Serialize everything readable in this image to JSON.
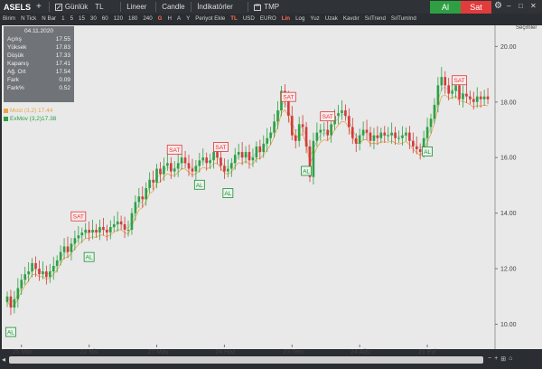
{
  "toolbar": {
    "symbol": "ASELS",
    "add_label": "+",
    "period_label": "Günlük",
    "currency": "TL",
    "scale": "Lineer",
    "chart_type": "Candle",
    "indicators_label": "İndikatörler",
    "template_label": "TMP",
    "buy_label": "Al",
    "sell_label": "Sat",
    "win_min": "–",
    "win_max": "□",
    "win_close": "✕"
  },
  "subtoolbar": {
    "items": [
      "Birim",
      "N Tick",
      "N Bar",
      "1",
      "5",
      "15",
      "30",
      "60",
      "120",
      "180",
      "240",
      "G",
      "H",
      "A",
      "Y",
      "Periyot Ekle",
      "TL",
      "USD",
      "EURO",
      "Lin",
      "Log",
      "Yuz",
      "Uzak",
      "Kavdır",
      "SılTrend",
      "SılTumInd"
    ]
  },
  "info": {
    "date": "04.11.2020",
    "rows": [
      {
        "label": "Açılış",
        "value": "17.55"
      },
      {
        "label": "Yüksek",
        "value": "17.83"
      },
      {
        "label": "Düşük",
        "value": "17.33"
      },
      {
        "label": "Kapanış",
        "value": "17.41"
      },
      {
        "label": "Ağ. Ort",
        "value": "17.54"
      },
      {
        "label": "Fark",
        "value": "0.09"
      },
      {
        "label": "Fark%",
        "value": "0.52"
      }
    ]
  },
  "legend": [
    {
      "label": "Most (3,2) 17.44",
      "color": "#e8a54a"
    },
    {
      "label": "ExMov (3,2)17.38",
      "color": "#2ea043"
    }
  ],
  "secimler": "Seçimler",
  "chart_data": {
    "type": "candlestick",
    "y_ticks": [
      10.0,
      12.0,
      14.0,
      16.0,
      18.0,
      20.0
    ],
    "ylim": [
      9.3,
      20.5
    ],
    "x_ticks": [
      "25 Mar",
      "22 Nis",
      "27 May",
      "24 Haz",
      "23 Tem",
      "24 Ağu",
      "21 Eyl"
    ],
    "x_tick_index": [
      4,
      23,
      42,
      61,
      80,
      99,
      118
    ],
    "closes": [
      11.0,
      10.6,
      10.9,
      11.3,
      11.6,
      11.8,
      11.9,
      12.2,
      12.0,
      11.8,
      11.9,
      11.7,
      11.9,
      12.1,
      12.3,
      12.6,
      12.8,
      12.6,
      12.9,
      13.1,
      13.2,
      13.3,
      13.4,
      13.3,
      13.4,
      13.3,
      13.5,
      13.4,
      13.3,
      13.5,
      13.6,
      13.7,
      13.6,
      13.4,
      13.4,
      14.0,
      14.4,
      14.6,
      14.5,
      14.9,
      15.2,
      15.1,
      15.6,
      15.4,
      15.7,
      15.8,
      15.5,
      15.6,
      15.8,
      16.0,
      15.8,
      15.6,
      15.5,
      15.7,
      15.9,
      16.0,
      15.8,
      15.9,
      16.2,
      16.0,
      15.7,
      15.5,
      15.6,
      15.8,
      16.1,
      16.2,
      16.0,
      16.2,
      15.9,
      16.0,
      16.4,
      16.2,
      16.5,
      16.7,
      16.9,
      17.3,
      17.7,
      18.4,
      18.1,
      17.5,
      16.8,
      16.6,
      17.2,
      17.1,
      16.4,
      15.3,
      16.6,
      16.9,
      17.0,
      17.0,
      16.8,
      17.2,
      17.5,
      17.6,
      17.7,
      17.5,
      17.1,
      16.7,
      16.5,
      16.8,
      17.0,
      16.9,
      16.6,
      16.8,
      16.7,
      16.9,
      16.8,
      16.8,
      16.9,
      16.7,
      16.7,
      16.8,
      16.9,
      16.6,
      16.4,
      16.3,
      16.2,
      16.7,
      17.1,
      17.4,
      17.9,
      18.6,
      18.9,
      18.6,
      18.3,
      18.4,
      18.6,
      18.1,
      18.3,
      18.2,
      18.1,
      18.0,
      18.2,
      18.1,
      18.2,
      18.1
    ],
    "signals": [
      {
        "type": "AL",
        "index": 1
      },
      {
        "type": "SAT",
        "index": 20
      },
      {
        "type": "AL",
        "index": 23
      },
      {
        "type": "SAT",
        "index": 47
      },
      {
        "type": "AL",
        "index": 54
      },
      {
        "type": "SAT",
        "index": 60
      },
      {
        "type": "AL",
        "index": 62
      },
      {
        "type": "SAT",
        "index": 79
      },
      {
        "type": "AL",
        "index": 84
      },
      {
        "type": "SAT",
        "index": 90
      },
      {
        "type": "AL",
        "index": 118
      },
      {
        "type": "SAT",
        "index": 127
      }
    ],
    "colors": {
      "up": "#2ea043",
      "down": "#d63a3a",
      "most": "#e8a54a",
      "exmov": "#2ea043",
      "bg": "#e9e9e9"
    }
  }
}
